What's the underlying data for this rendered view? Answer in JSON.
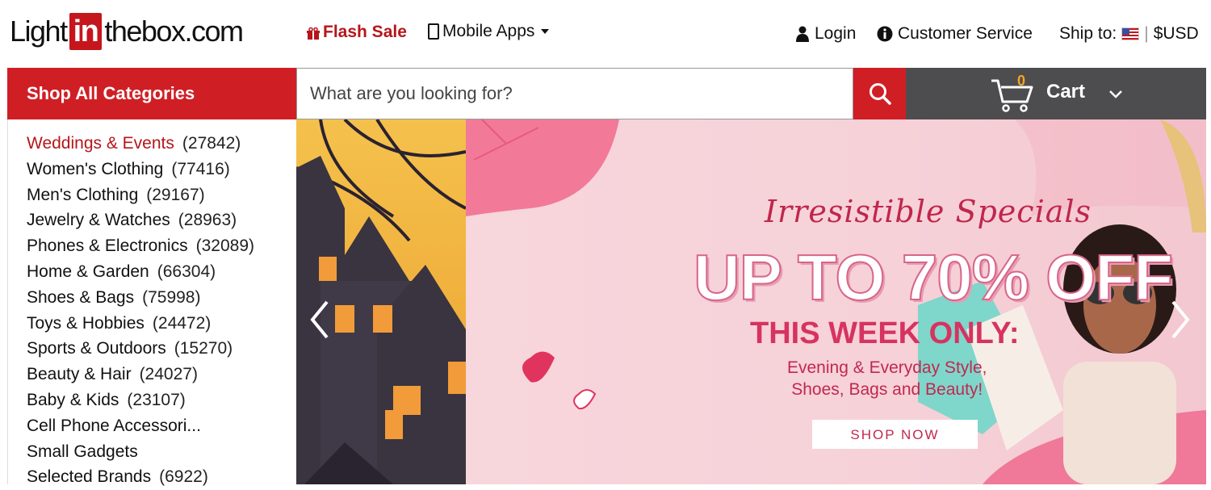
{
  "header": {
    "logo": {
      "pre": "Light",
      "mid": "in",
      "post": "thebox.com"
    },
    "flash_sale": "Flash Sale",
    "mobile_apps": "Mobile Apps",
    "login": "Login",
    "customer_service": "Customer Service",
    "ship_to": "Ship to:",
    "currency": "$USD"
  },
  "nav": {
    "shop_all": "Shop All Categories",
    "search_placeholder": "What are you looking for?",
    "cart_count": "0",
    "cart_label": "Cart"
  },
  "categories": [
    {
      "name": "Weddings & Events",
      "count": "(27842)"
    },
    {
      "name": "Women's Clothing",
      "count": "(77416)"
    },
    {
      "name": "Men's Clothing",
      "count": "(29167)"
    },
    {
      "name": "Jewelry & Watches",
      "count": "(28963)"
    },
    {
      "name": "Phones & Electronics",
      "count": "(32089)"
    },
    {
      "name": "Home & Garden",
      "count": "(66304)"
    },
    {
      "name": "Shoes & Bags",
      "count": "(75998)"
    },
    {
      "name": "Toys & Hobbies",
      "count": "(24472)"
    },
    {
      "name": "Sports & Outdoors",
      "count": "(15270)"
    },
    {
      "name": "Beauty & Hair",
      "count": "(24027)"
    },
    {
      "name": "Baby & Kids",
      "count": "(23107)"
    },
    {
      "name": "Cell Phone Accessori...",
      "count": ""
    },
    {
      "name": "Small Gadgets",
      "count": ""
    },
    {
      "name": "Selected Brands",
      "count": "(6922)"
    }
  ],
  "banner": {
    "script": "Irresistible Specials",
    "headline": "UP TO 70% OFF",
    "week": "THIS WEEK ONLY:",
    "sub1": "Evening & Everyday Style,",
    "sub2": "Shoes, Bags and Beauty!",
    "button": "SHOP NOW"
  },
  "colors": {
    "brand_red": "#cf1f25",
    "cart_gray": "#4d4d4f",
    "banner_pink": "#f6d1d8",
    "accent_pink": "#d63360"
  },
  "icons": [
    "gift-icon",
    "phone-icon",
    "user-icon",
    "info-icon",
    "us-flag-icon",
    "search-icon",
    "cart-icon",
    "chevron-down-icon",
    "arrow-left-icon",
    "arrow-right-icon"
  ]
}
